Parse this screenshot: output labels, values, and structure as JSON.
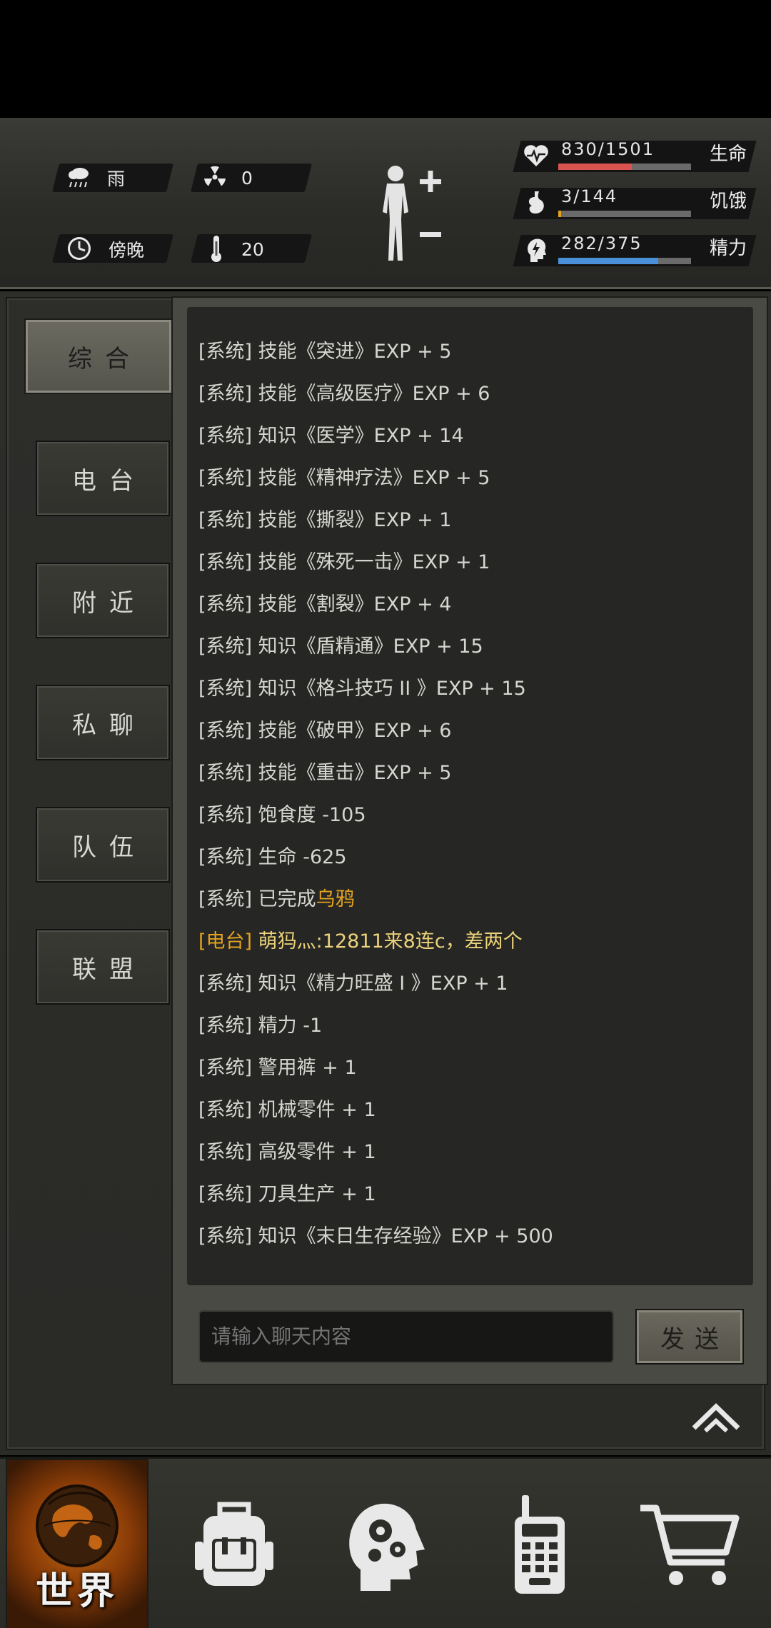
{
  "header": {
    "weather": {
      "icon": "rain-cloud-icon",
      "label": "雨"
    },
    "radiation": {
      "icon": "radiation-icon",
      "value": "0"
    },
    "time": {
      "icon": "clock-icon",
      "label": "傍晚"
    },
    "temperature": {
      "icon": "thermometer-icon",
      "value": "20"
    },
    "stats": [
      {
        "key": "health",
        "icon": "heart-pulse-icon",
        "value": "830/1501",
        "label": "生命",
        "fraction": 0.553,
        "color": "#d9534f"
      },
      {
        "key": "hunger",
        "icon": "stomach-icon",
        "value": "3/144",
        "label": "饥饿",
        "fraction": 0.021,
        "color": "#e3a321"
      },
      {
        "key": "energy",
        "icon": "brain-energy-icon",
        "value": "282/375",
        "label": "精力",
        "fraction": 0.752,
        "color": "#4a90d9"
      }
    ]
  },
  "tabs": [
    {
      "label": "综合",
      "active": true
    },
    {
      "label": "电台",
      "active": false
    },
    {
      "label": "附近",
      "active": false
    },
    {
      "label": "私聊",
      "active": false
    },
    {
      "label": "队伍",
      "active": false
    },
    {
      "label": "联盟",
      "active": false
    }
  ],
  "chat": {
    "lines": [
      {
        "prefix": "[系统]",
        "text": "技能《突进》EXP + 5"
      },
      {
        "prefix": "[系统]",
        "text": "技能《高级医疗》EXP + 6"
      },
      {
        "prefix": "[系统]",
        "text": "知识《医学》EXP + 14"
      },
      {
        "prefix": "[系统]",
        "text": "技能《精神疗法》EXP + 5"
      },
      {
        "prefix": "[系统]",
        "text": "技能《撕裂》EXP + 1"
      },
      {
        "prefix": "[系统]",
        "text": "技能《殊死一击》EXP + 1"
      },
      {
        "prefix": "[系统]",
        "text": "技能《割裂》EXP + 4"
      },
      {
        "prefix": "[系统]",
        "text": "知识《盾精通》EXP + 15"
      },
      {
        "prefix": "[系统]",
        "text": "知识《格斗技巧 II 》EXP + 15"
      },
      {
        "prefix": "[系统]",
        "text": "技能《破甲》EXP + 6"
      },
      {
        "prefix": "[系统]",
        "text": "技能《重击》EXP + 5"
      },
      {
        "prefix": "[系统]",
        "text": "饱食度 -105"
      },
      {
        "prefix": "[系统]",
        "text": "生命 -625"
      },
      {
        "prefix": "[系统]",
        "text": "已完成",
        "highlight": "乌鸦"
      },
      {
        "prefix": "[电台]",
        "radio_name": "萌犸灬:",
        "text": "12811来8连c，差两个"
      },
      {
        "prefix": "[系统]",
        "text": "知识《精力旺盛 I 》EXP + 1"
      },
      {
        "prefix": "[系统]",
        "text": "精力 -1"
      },
      {
        "prefix": "[系统]",
        "text": "警用裤 + 1"
      },
      {
        "prefix": "[系统]",
        "text": "机械零件 + 1"
      },
      {
        "prefix": "[系统]",
        "text": "高级零件 + 1"
      },
      {
        "prefix": "[系统]",
        "text": "刀具生产 + 1"
      },
      {
        "prefix": "[系统]",
        "text": "知识《末日生存经验》EXP + 500"
      }
    ],
    "input_placeholder": "请输入聊天内容",
    "send_label": "发送"
  },
  "nav": [
    {
      "key": "world",
      "icon": "globe-icon",
      "label": "世界",
      "active": true
    },
    {
      "key": "inventory",
      "icon": "backpack-icon"
    },
    {
      "key": "skills",
      "icon": "head-gears-icon"
    },
    {
      "key": "radio",
      "icon": "walkie-talkie-icon"
    },
    {
      "key": "shop",
      "icon": "shopping-cart-icon"
    }
  ]
}
